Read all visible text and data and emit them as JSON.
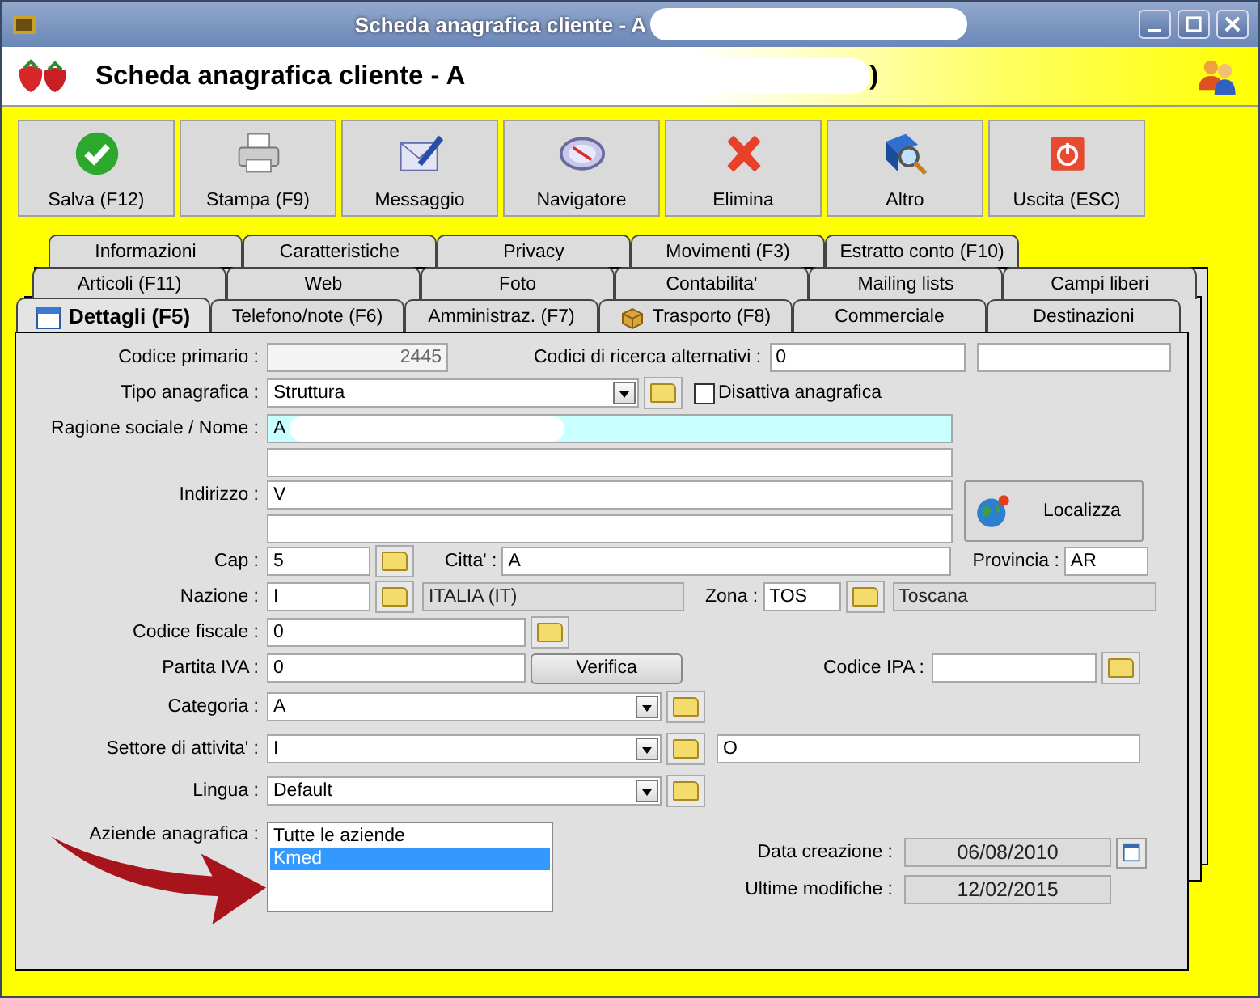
{
  "window": {
    "title": "Scheda anagrafica cliente - A"
  },
  "header": {
    "title": "Scheda anagrafica cliente - A",
    "title_end": ")"
  },
  "toolbar": [
    {
      "label": "Salva (F12)",
      "kind": "save"
    },
    {
      "label": "Stampa (F9)",
      "kind": "print"
    },
    {
      "label": "Messaggio",
      "kind": "message"
    },
    {
      "label": "Navigatore",
      "kind": "navigator"
    },
    {
      "label": "Elimina",
      "kind": "delete"
    },
    {
      "label": "Altro",
      "kind": "more"
    },
    {
      "label": "Uscita (ESC)",
      "kind": "exit"
    }
  ],
  "tab_rows": [
    [
      {
        "label": "Informazioni",
        "selected": false,
        "kind": "plain"
      },
      {
        "label": "Caratteristiche",
        "selected": false,
        "kind": "plain"
      },
      {
        "label": "Privacy",
        "selected": false,
        "kind": "plain"
      },
      {
        "label": "Movimenti (F3)",
        "selected": false,
        "kind": "plain"
      },
      {
        "label": "Estratto conto (F10)",
        "selected": false,
        "kind": "plain"
      }
    ],
    [
      {
        "label": "Articoli (F11)",
        "selected": false,
        "kind": "plain"
      },
      {
        "label": "Web",
        "selected": false,
        "kind": "plain"
      },
      {
        "label": "Foto",
        "selected": false,
        "kind": "plain"
      },
      {
        "label": "Contabilita'",
        "selected": false,
        "kind": "plain"
      },
      {
        "label": "Mailing lists",
        "selected": false,
        "kind": "plain"
      },
      {
        "label": "Campi liberi",
        "selected": false,
        "kind": "plain"
      }
    ],
    [
      {
        "label": "Dettagli (F5)",
        "selected": true,
        "kind": "calendar"
      },
      {
        "label": "Telefono/note (F6)",
        "selected": false,
        "kind": "plain"
      },
      {
        "label": "Amministraz. (F7)",
        "selected": false,
        "kind": "plain"
      },
      {
        "label": "Trasporto (F8)",
        "selected": false,
        "kind": "parcel"
      },
      {
        "label": "Commerciale",
        "selected": false,
        "kind": "plain"
      },
      {
        "label": "Destinazioni",
        "selected": false,
        "kind": "plain"
      }
    ]
  ],
  "form": {
    "codice_primario": {
      "label": "Codice primario :",
      "value": "2445"
    },
    "codici_alternativi": {
      "label": "Codici di ricerca alternativi :",
      "value": "0"
    },
    "tipo_anagrafica": {
      "label": "Tipo anagrafica :",
      "value": "Struttura"
    },
    "disattiva": {
      "label": "Disattiva anagrafica",
      "checked": false
    },
    "ragione_sociale": {
      "label": "Ragione sociale / Nome :",
      "value": "A"
    },
    "indirizzo": {
      "label": "Indirizzo :",
      "value": "V"
    },
    "localizza": {
      "label": "Localizza"
    },
    "cap": {
      "label": "Cap :",
      "value": "5"
    },
    "citta": {
      "label": "Citta' :",
      "value": "A"
    },
    "provincia": {
      "label": "Provincia :",
      "value": "AR"
    },
    "nazione": {
      "label": "Nazione :",
      "value": "I",
      "description": "ITALIA (IT)"
    },
    "zona": {
      "label": "Zona :",
      "value": "TOS",
      "description": "Toscana"
    },
    "codice_fiscale": {
      "label": "Codice fiscale :",
      "value": "0"
    },
    "partita_iva": {
      "label": "Partita IVA :",
      "value": "0"
    },
    "verifica": {
      "label": "Verifica"
    },
    "codice_ipa": {
      "label": "Codice IPA :"
    },
    "categoria": {
      "label": "Categoria :",
      "value": "A"
    },
    "settore": {
      "label": "Settore di attivita' :",
      "value": "I",
      "description": "O"
    },
    "lingua": {
      "label": "Lingua :",
      "value": "Default"
    },
    "aziende": {
      "label": "Aziende anagrafica :",
      "items": [
        {
          "label": "Tutte le aziende",
          "selected": false
        },
        {
          "label": "Kmed",
          "selected": true
        }
      ]
    },
    "data_creazione": {
      "label": "Data creazione :",
      "value": "06/08/2010"
    },
    "ultime_modifiche": {
      "label": "Ultime modifiche :",
      "value": "12/02/2015"
    }
  }
}
